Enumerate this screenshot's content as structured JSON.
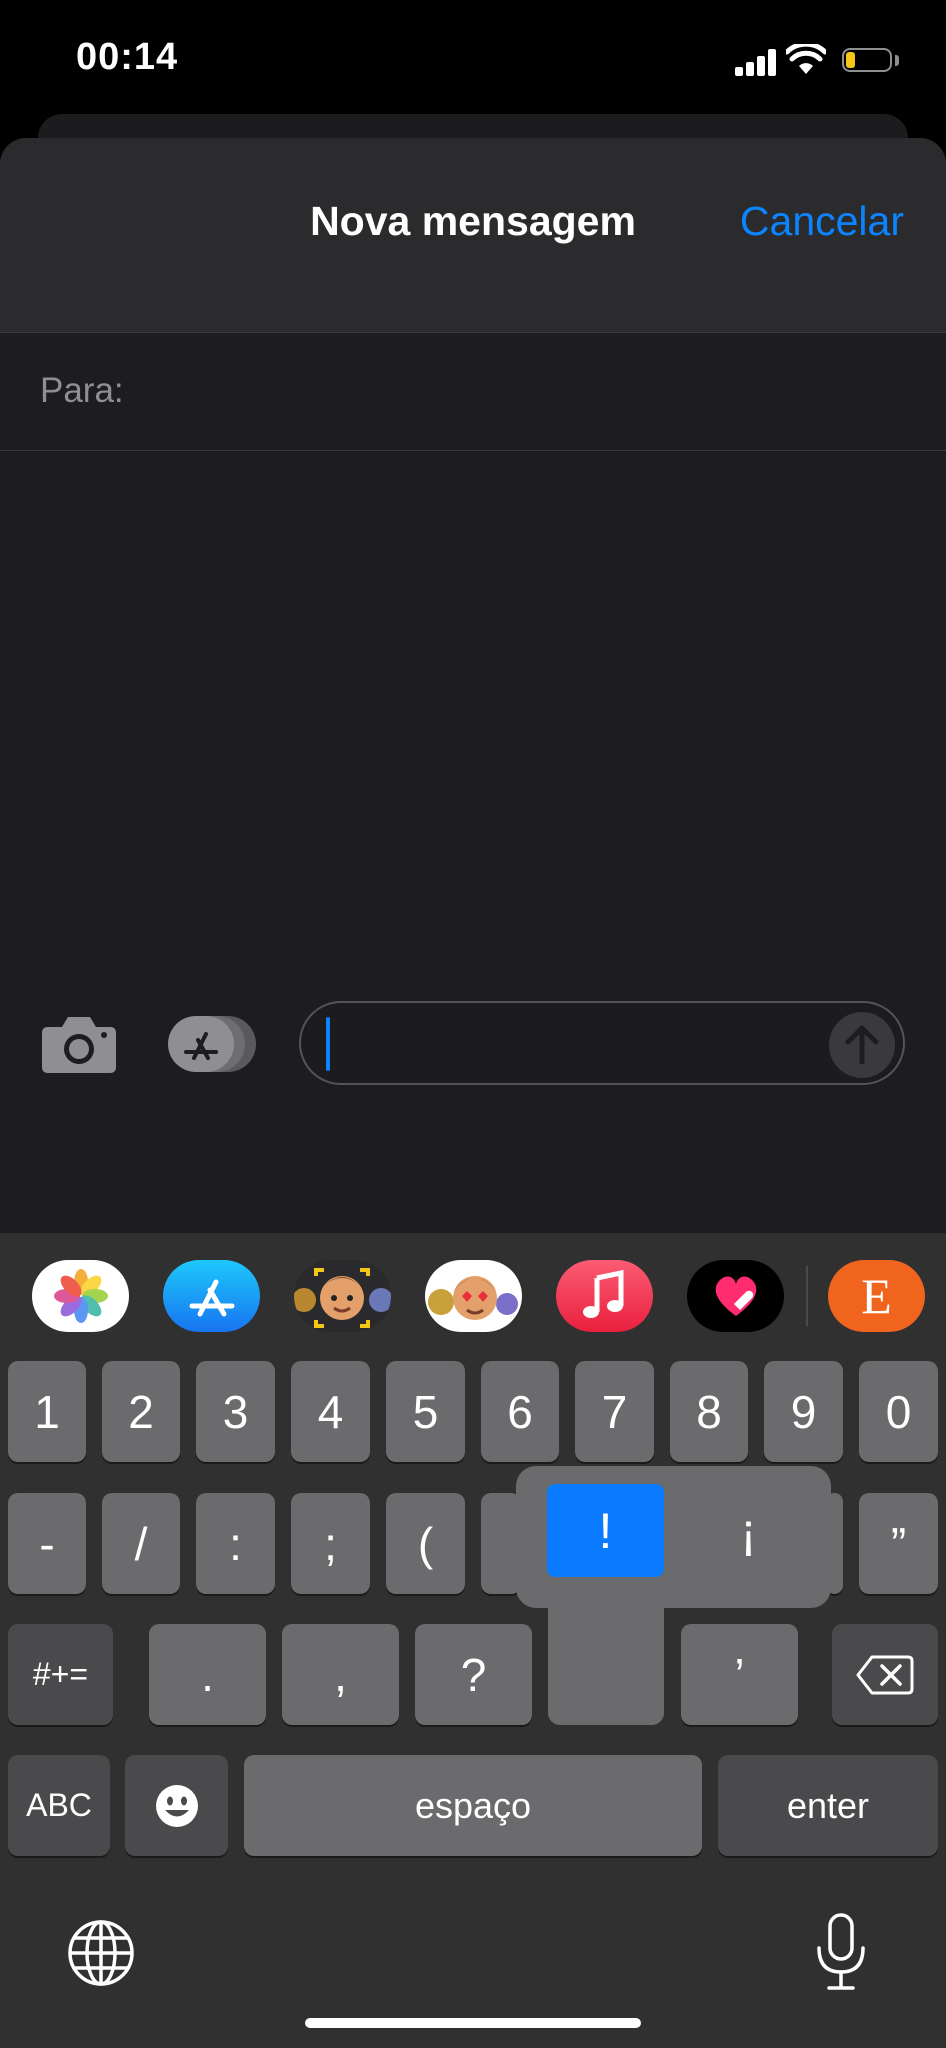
{
  "status_bar": {
    "time": "00:14",
    "battery_level": 0.2
  },
  "header": {
    "title": "Nova mensagem",
    "cancel_label": "Cancelar"
  },
  "recipient": {
    "label": "Para:"
  },
  "compose": {
    "camera_icon": "camera-icon",
    "apps_icon": "app-store-icon",
    "send_icon": "arrow-up-icon"
  },
  "app_strip": [
    {
      "name": "photos",
      "icon": "photos-icon"
    },
    {
      "name": "app-store",
      "icon": "app-store-icon"
    },
    {
      "name": "memoji-camera",
      "icon": "memoji-camera-icon"
    },
    {
      "name": "memoji-stickers",
      "icon": "memoji-stickers-icon"
    },
    {
      "name": "music",
      "icon": "music-note-icon"
    },
    {
      "name": "digital-touch",
      "icon": "heart-icon"
    },
    {
      "name": "etsy",
      "icon": "etsy-icon",
      "letter": "E"
    }
  ],
  "keyboard": {
    "row1": [
      "1",
      "2",
      "3",
      "4",
      "5",
      "6",
      "7",
      "8",
      "9",
      "0"
    ],
    "row2": [
      "-",
      "/",
      ":",
      ";",
      "(",
      "”"
    ],
    "row3_mode": "#+=",
    "row3": [
      ".",
      ",",
      "?",
      "’"
    ],
    "popup": {
      "selected": "!",
      "alternate": "¡"
    },
    "abc_label": "ABC",
    "space_label": "espaço",
    "return_label": "enter"
  },
  "colors": {
    "accent": "#0a84ff",
    "background": "#1d1d1f",
    "key": "#6b6b6e"
  }
}
